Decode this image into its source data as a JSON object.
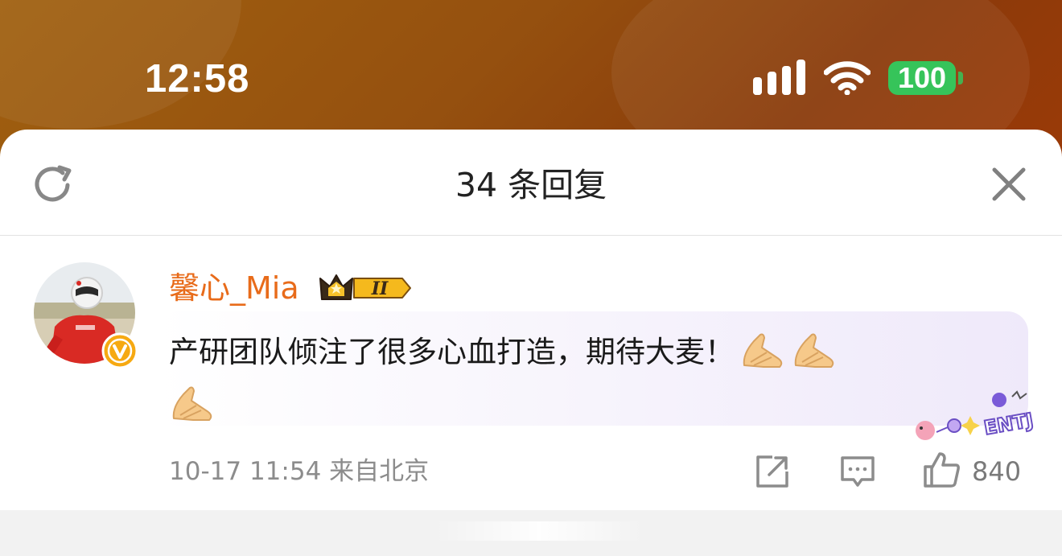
{
  "status_bar": {
    "time": "12:58",
    "battery": "100",
    "signal_icon": "cellular-signal-icon",
    "wifi_icon": "wifi-icon"
  },
  "header": {
    "title": "34 条回复",
    "refresh_icon": "refresh-icon",
    "close_icon": "close-icon"
  },
  "comment": {
    "username": "馨心_Mia",
    "vip_level": "II",
    "text": "产研团队倾注了很多心血打造，期待大麦！",
    "emoji": [
      "palms-together-emoji",
      "palms-together-emoji",
      "palms-together-emoji"
    ],
    "sticker_text": "ENTJ",
    "date": "10-17",
    "time": "11:54",
    "location": "来自北京",
    "likes": "840"
  },
  "colors": {
    "username": "#e86b1a",
    "battery": "#36c45a",
    "meta": "#8c8c8c"
  }
}
